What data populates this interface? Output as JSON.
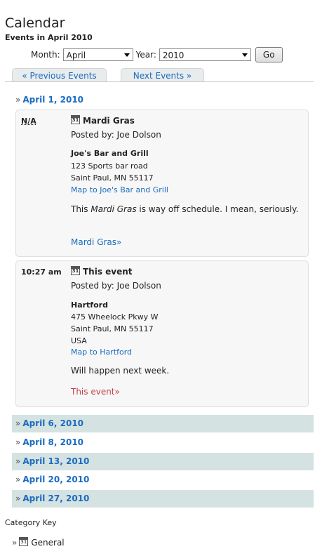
{
  "header": {
    "title": "Calendar",
    "subtitle": "Events in April 2010"
  },
  "form": {
    "month_label": "Month:",
    "month_value": "April",
    "year_label": "Year:",
    "year_value": "2010",
    "go_label": "Go"
  },
  "nav": {
    "prev_label": "« Previous Events",
    "next_label": "Next Events »"
  },
  "quote": "»",
  "days": [
    {
      "label": "April 1, 2010"
    },
    {
      "label": "April 6, 2010"
    },
    {
      "label": "April 8, 2010"
    },
    {
      "label": "April 13, 2010"
    },
    {
      "label": "April 20, 2010"
    },
    {
      "label": "April 27, 2010"
    }
  ],
  "events": [
    {
      "time": "N/A",
      "title": "Mardi Gras",
      "posted_by": "Posted by: Joe Dolson",
      "venue": "Joe's Bar and Grill",
      "street": "123 Sports bar road",
      "city": "Saint Paul, MN 55117",
      "map_link": "Map to Joe's Bar and Grill",
      "desc_pre": "This ",
      "desc_em": "Mardi Gras",
      "desc_post": " is way off schedule. I mean, seriously.",
      "more_link": "Mardi Gras»"
    },
    {
      "time": "10:27 am",
      "title": "This event",
      "posted_by": "Posted by: Joe Dolson",
      "venue": "Hartford",
      "street": "475 Wheelock Pkwy W",
      "city": "Saint Paul, MN 55117",
      "country": "USA",
      "map_link": "Map to Hartford",
      "description": "Will happen next week.",
      "more_link": "This event»"
    }
  ],
  "category_key": {
    "title": "Category Key",
    "items": [
      {
        "label": "General"
      }
    ]
  },
  "colors": {
    "link": "#1a6bc0",
    "shade": "#d4e2e2",
    "event_bg": "#f7f7f7",
    "more_link_red": "#c0424a"
  }
}
